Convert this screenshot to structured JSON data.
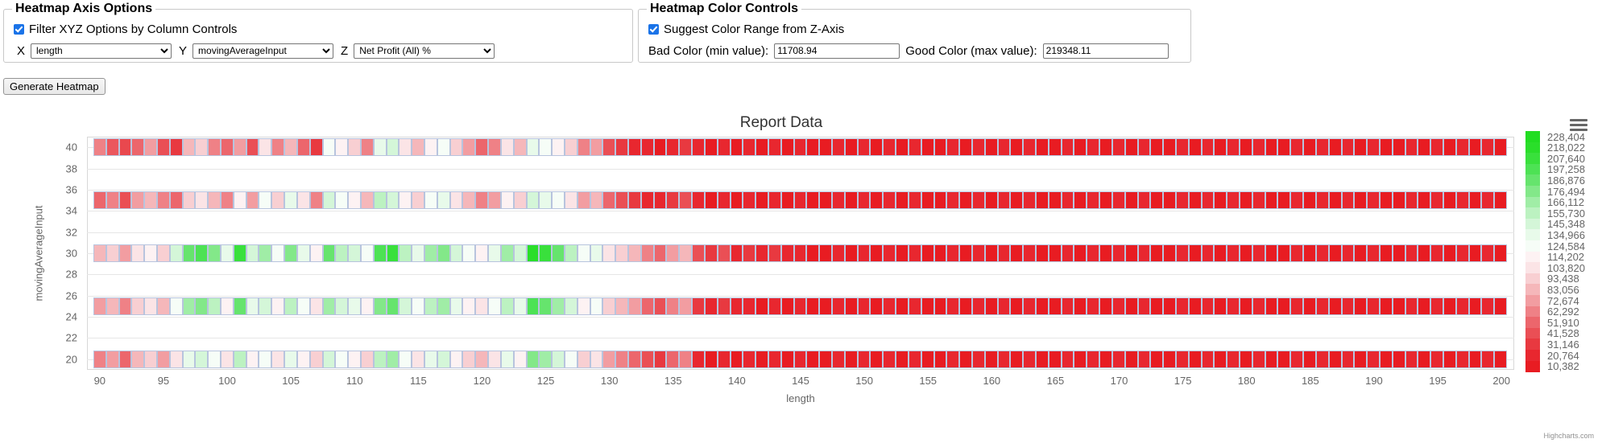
{
  "axis_options": {
    "legend": "Heatmap Axis Options",
    "filter_checkbox_label": "Filter XYZ Options by Column Controls",
    "filter_checked": true,
    "x_letter": "X",
    "y_letter": "Y",
    "z_letter": "Z",
    "x_value": "length",
    "y_value": "movingAverageInput",
    "z_value": "Net Profit (All) %",
    "x_options": [
      "length",
      "movingAverageInput",
      "Net Profit (All) %"
    ],
    "y_options": [
      "length",
      "movingAverageInput",
      "Net Profit (All) %"
    ],
    "z_options": [
      "length",
      "movingAverageInput",
      "Net Profit (All) %"
    ]
  },
  "color_controls": {
    "legend": "Heatmap Color Controls",
    "suggest_checkbox_label": "Suggest Color Range from Z-Axis",
    "suggest_checked": true,
    "bad_color_label": "Bad Color (min value):",
    "bad_color_value": "11708.94",
    "good_color_label": "Good Color (max value):",
    "good_color_value": "219348.11"
  },
  "generate_button_label": "Generate Heatmap",
  "credits": "Highcharts.com",
  "icons": {
    "context_menu": "hamburger-menu-icon"
  },
  "chart_data": {
    "type": "heatmap",
    "title": "Report Data",
    "xlabel": "length",
    "ylabel": "movingAverageInput",
    "xlim": [
      89,
      201
    ],
    "ylim": [
      19,
      41
    ],
    "x_ticks": [
      90,
      95,
      100,
      105,
      110,
      115,
      120,
      125,
      130,
      135,
      140,
      145,
      150,
      155,
      160,
      165,
      170,
      175,
      180,
      185,
      190,
      195,
      200
    ],
    "y_ticks": [
      20,
      22,
      24,
      26,
      28,
      30,
      32,
      34,
      36,
      38,
      40
    ],
    "y_rows": [
      20,
      25,
      30,
      35,
      40
    ],
    "x_start": 90,
    "x_end": 200,
    "x_step": 1,
    "grid": true,
    "zmin": 10382,
    "zmax": 228404,
    "legend_position": "right",
    "legend_labels": [
      "228,404",
      "218,022",
      "207,640",
      "197,258",
      "186,876",
      "176,494",
      "166,112",
      "155,730",
      "145,348",
      "134,966",
      "124,584",
      "114,202",
      "103,820",
      "93,438",
      "83,056",
      "72,674",
      "62,292",
      "51,910",
      "41,528",
      "31,146",
      "20,764",
      "10,382"
    ],
    "legend_colors": [
      "#22dd22",
      "#2ade2a",
      "#39e03c",
      "#4de254",
      "#66e46d",
      "#83e889",
      "#a0eda6",
      "#bcf2c1",
      "#d4f6d8",
      "#e8faea",
      "#f6fdf7",
      "#fdf2f3",
      "#fbe4e6",
      "#f8cfd2",
      "#f5b7ba",
      "#f29da1",
      "#ef8186",
      "#ec666c",
      "#ea4f55",
      "#e83940",
      "#e8272f",
      "#e81c22"
    ],
    "series_rows": [
      {
        "y": 40,
        "values": [
          62292,
          45000,
          38000,
          51910,
          72674,
          41528,
          31146,
          83056,
          93438,
          62292,
          51910,
          72674,
          41528,
          103820,
          62292,
          83056,
          51910,
          31146,
          124584,
          114202,
          93438,
          62292,
          134966,
          145348,
          103820,
          83056,
          114202,
          124584,
          93438,
          72674,
          51910,
          62292,
          103820,
          83056,
          134966,
          124584,
          114202,
          93438,
          62292,
          72674,
          41528,
          31146,
          20764,
          20764,
          10382,
          20764,
          31146,
          20764,
          10382,
          20764,
          10382,
          20764,
          10382,
          20764,
          10382,
          20764,
          10382,
          10382,
          20764,
          10382,
          20764,
          10382,
          20764,
          10382,
          20764,
          10382,
          10382,
          20764,
          10382,
          20764,
          10382,
          20764,
          10382,
          20764,
          10382,
          10382,
          20764,
          10382,
          20764,
          10382,
          20764,
          10382,
          20764,
          10382,
          10382,
          20764,
          10382,
          20764,
          10382,
          20764,
          10382,
          20764,
          10382,
          10382,
          20764,
          10382,
          20764,
          10382,
          20764,
          10382,
          20764,
          10382,
          10382,
          20764,
          10382,
          20764,
          10382,
          20764,
          10382,
          20764,
          10382
        ]
      },
      {
        "y": 35,
        "values": [
          51910,
          62292,
          41528,
          72674,
          83056,
          62292,
          51910,
          93438,
          103820,
          83056,
          62292,
          114202,
          72674,
          124584,
          93438,
          134966,
          103820,
          62292,
          145348,
          124584,
          114202,
          83056,
          155730,
          145348,
          114202,
          93438,
          124584,
          134966,
          103820,
          83056,
          62292,
          72674,
          114202,
          93438,
          145348,
          134966,
          124584,
          103820,
          72674,
          83056,
          51910,
          41528,
          31146,
          20764,
          20764,
          31146,
          41528,
          20764,
          10382,
          20764,
          10382,
          20764,
          10382,
          20764,
          10382,
          20764,
          10382,
          10382,
          20764,
          10382,
          20764,
          10382,
          20764,
          10382,
          20764,
          10382,
          10382,
          20764,
          10382,
          20764,
          10382,
          20764,
          10382,
          20764,
          10382,
          10382,
          20764,
          10382,
          20764,
          10382,
          20764,
          10382,
          20764,
          10382,
          10382,
          20764,
          10382,
          20764,
          10382,
          20764,
          10382,
          20764,
          10382,
          10382,
          20764,
          10382,
          20764,
          10382,
          20764,
          10382,
          20764,
          10382,
          10382,
          20764,
          10382,
          20764,
          10382,
          20764,
          10382,
          20764,
          10382
        ]
      },
      {
        "y": 30,
        "values": [
          83056,
          93438,
          72674,
          103820,
          114202,
          93438,
          145348,
          186876,
          197258,
          176494,
          134966,
          207640,
          145348,
          166112,
          124584,
          176494,
          134966,
          114202,
          186876,
          155730,
          145348,
          124584,
          197258,
          207640,
          155730,
          134966,
          166112,
          176494,
          145348,
          124584,
          114202,
          134966,
          166112,
          145348,
          218022,
          207640,
          186876,
          155730,
          124584,
          134966,
          103820,
          93438,
          83056,
          62292,
          51910,
          72674,
          83056,
          41528,
          31146,
          41528,
          20764,
          31146,
          20764,
          31146,
          20764,
          20764,
          10382,
          10382,
          20764,
          10382,
          20764,
          10382,
          20764,
          10382,
          20764,
          10382,
          10382,
          20764,
          10382,
          20764,
          10382,
          20764,
          10382,
          20764,
          10382,
          10382,
          20764,
          10382,
          20764,
          10382,
          20764,
          10382,
          20764,
          10382,
          10382,
          20764,
          10382,
          20764,
          10382,
          20764,
          10382,
          20764,
          10382,
          10382,
          20764,
          10382,
          20764,
          10382,
          20764,
          10382,
          20764,
          10382,
          10382,
          20764,
          10382,
          20764,
          10382,
          20764,
          10382,
          20764,
          10382
        ]
      },
      {
        "y": 25,
        "values": [
          72674,
          83056,
          62292,
          93438,
          103820,
          83056,
          124584,
          166112,
          176494,
          155730,
          114202,
          186876,
          134966,
          145348,
          114202,
          155730,
          124584,
          103820,
          166112,
          145348,
          134966,
          114202,
          176494,
          186876,
          145348,
          124584,
          155730,
          166112,
          134966,
          114202,
          103820,
          124584,
          155730,
          134966,
          197258,
          186876,
          166112,
          145348,
          114202,
          124584,
          93438,
          83056,
          72674,
          51910,
          41528,
          62292,
          72674,
          31146,
          20764,
          31146,
          20764,
          20764,
          10382,
          20764,
          10382,
          20764,
          10382,
          10382,
          20764,
          10382,
          20764,
          10382,
          20764,
          10382,
          20764,
          10382,
          10382,
          20764,
          10382,
          20764,
          10382,
          20764,
          10382,
          20764,
          10382,
          10382,
          20764,
          10382,
          20764,
          10382,
          20764,
          10382,
          20764,
          10382,
          10382,
          20764,
          10382,
          20764,
          10382,
          20764,
          10382,
          20764,
          10382,
          10382,
          20764,
          10382,
          20764,
          10382,
          20764,
          10382,
          20764,
          10382,
          10382,
          20764,
          10382,
          20764,
          10382,
          20764,
          10382,
          20764,
          10382
        ]
      },
      {
        "y": 20,
        "values": [
          62292,
          72674,
          51910,
          83056,
          93438,
          72674,
          103820,
          134966,
          145348,
          124584,
          103820,
          155730,
          114202,
          124584,
          103820,
          134966,
          114202,
          93438,
          145348,
          124584,
          114202,
          93438,
          155730,
          166112,
          124584,
          103820,
          134966,
          145348,
          114202,
          93438,
          83056,
          103820,
          134966,
          114202,
          176494,
          166112,
          145348,
          124584,
          93438,
          103820,
          72674,
          62292,
          51910,
          41528,
          31146,
          51910,
          62292,
          20764,
          10382,
          20764,
          10382,
          20764,
          10382,
          20764,
          10382,
          20764,
          10382,
          10382,
          20764,
          10382,
          20764,
          10382,
          20764,
          10382,
          20764,
          10382,
          10382,
          20764,
          10382,
          20764,
          10382,
          20764,
          10382,
          20764,
          10382,
          10382,
          20764,
          10382,
          20764,
          10382,
          20764,
          10382,
          20764,
          10382,
          10382,
          20764,
          10382,
          20764,
          10382,
          20764,
          10382,
          20764,
          10382,
          10382,
          20764,
          10382,
          20764,
          10382,
          20764,
          10382,
          20764,
          10382,
          10382,
          20764,
          10382,
          20764,
          10382,
          20764,
          10382,
          20764,
          10382
        ]
      }
    ]
  }
}
